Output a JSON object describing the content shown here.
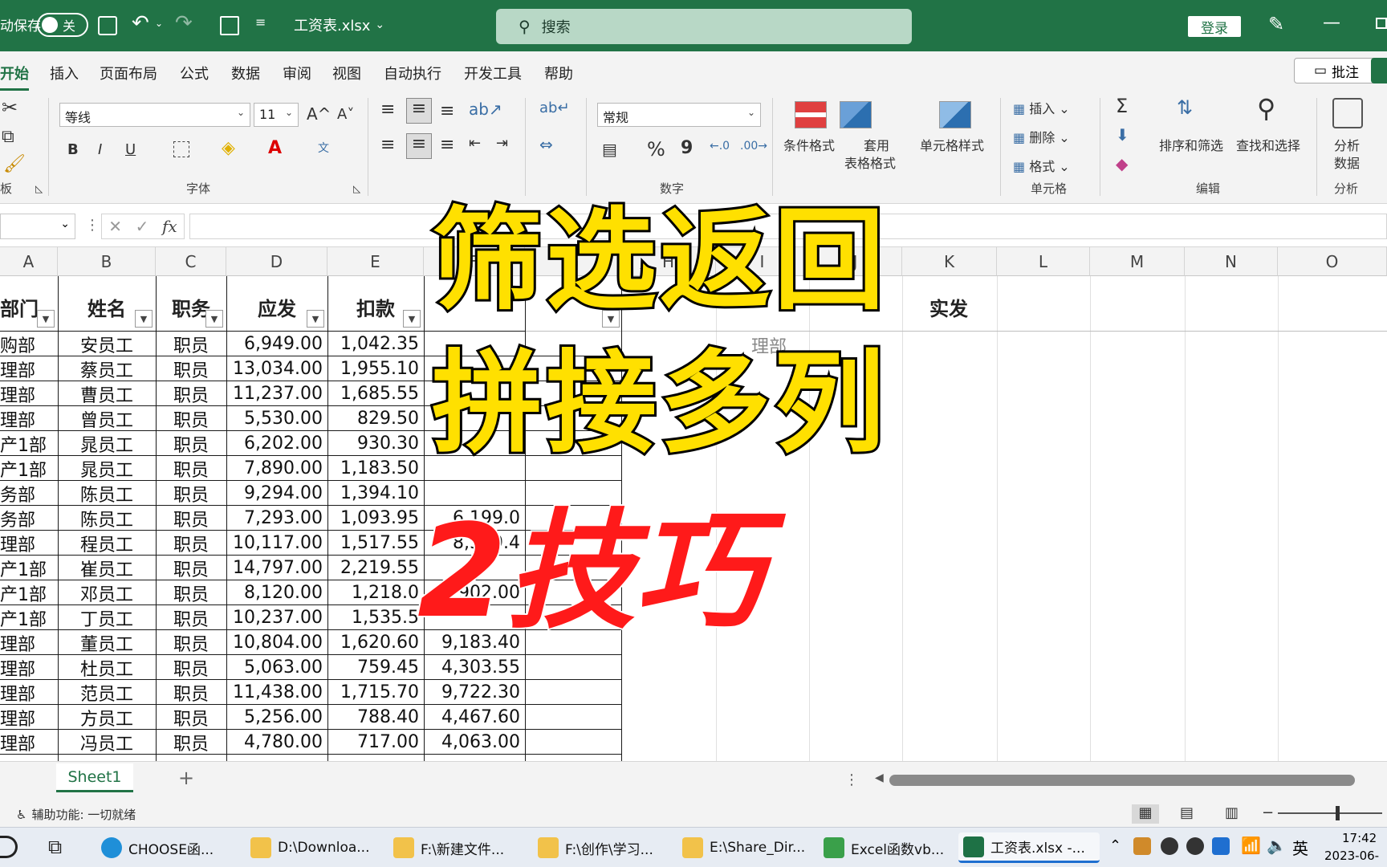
{
  "titlebar": {
    "autosave_label": "动保存",
    "autosave_state": "关",
    "filename": "工资表.xlsx",
    "search_placeholder": "搜索",
    "login": "登录"
  },
  "menu": {
    "tabs": [
      "开始",
      "插入",
      "页面布局",
      "公式",
      "数据",
      "审阅",
      "视图",
      "自动执行",
      "开发工具",
      "帮助"
    ],
    "comment_button": "批注"
  },
  "ribbon": {
    "font_name": "等线",
    "font_size": "11",
    "number_format": "常规",
    "bold": "B",
    "italic": "I",
    "underline": "U",
    "grow_font": "A^",
    "shrink_font": "A˅",
    "font_group": "字体",
    "number_group": "数字",
    "percent": "%",
    "comma": "9",
    "conditional_format": "条件格式",
    "table_format_1": "套用",
    "table_format_2": "表格格式",
    "cell_style": "单元格样式",
    "insert": "插入",
    "delete": "删除",
    "format": "格式",
    "cells_group": "单元格",
    "sort_filter": "排序和筛选",
    "find_select": "查找和选择",
    "edit_group": "编辑",
    "analyze_1": "分析",
    "analyze_2": "数据",
    "analyze_group": "分析",
    "clipboard_group": "板"
  },
  "formula_bar": {
    "fx": "fx",
    "cancel": "✕",
    "confirm": "✓"
  },
  "sheet": {
    "columns": [
      "A",
      "B",
      "C",
      "D",
      "E",
      "F",
      "G",
      "H",
      "I",
      "J",
      "K",
      "L",
      "M",
      "N",
      "O"
    ],
    "headers": [
      "部门",
      "姓名",
      "职务",
      "应发",
      "扣款"
    ],
    "extra_header": "实发",
    "ghost_text": "理部",
    "rows": [
      [
        "购部",
        "安员工",
        "职员",
        "6,949.00",
        "1,042.35",
        ""
      ],
      [
        "理部",
        "蔡员工",
        "职员",
        "13,034.00",
        "1,955.10",
        ""
      ],
      [
        "理部",
        "曹员工",
        "职员",
        "11,237.00",
        "1,685.55",
        ""
      ],
      [
        "理部",
        "曾员工",
        "职员",
        "5,530.00",
        "829.50",
        ""
      ],
      [
        "产1部",
        "晁员工",
        "职员",
        "6,202.00",
        "930.30",
        ""
      ],
      [
        "产1部",
        "晁员工",
        "职员",
        "7,890.00",
        "1,183.50",
        ""
      ],
      [
        "务部",
        "陈员工",
        "职员",
        "9,294.00",
        "1,394.10",
        ""
      ],
      [
        "务部",
        "陈员工",
        "职员",
        "7,293.00",
        "1,093.95",
        "6,199.0"
      ],
      [
        "理部",
        "程员工",
        "职员",
        "10,117.00",
        "1,517.55",
        "8,599.4"
      ],
      [
        "产1部",
        "崔员工",
        "职员",
        "14,797.00",
        "2,219.55",
        ""
      ],
      [
        "产1部",
        "邓员工",
        "职员",
        "8,120.00",
        "1,218.0",
        "902.00"
      ],
      [
        "产1部",
        "丁员工",
        "职员",
        "10,237.00",
        "1,535.5",
        ""
      ],
      [
        "理部",
        "董员工",
        "职员",
        "10,804.00",
        "1,620.60",
        "9,183.40"
      ],
      [
        "理部",
        "杜员工",
        "职员",
        "5,063.00",
        "759.45",
        "4,303.55"
      ],
      [
        "理部",
        "范员工",
        "职员",
        "11,438.00",
        "1,715.70",
        "9,722.30"
      ],
      [
        "理部",
        "方员工",
        "职员",
        "5,256.00",
        "788.40",
        "4,467.60"
      ],
      [
        "理部",
        "冯员工",
        "职员",
        "4,780.00",
        "717.00",
        "4,063.00"
      ]
    ],
    "tab_name": "Sheet1",
    "add_sheet": "+"
  },
  "overlay": {
    "line1": "筛选返回",
    "line2": "拼接多列",
    "line3": "2技巧"
  },
  "statusbar": {
    "accessibility": "辅助功能: 一切就绪"
  },
  "taskbar": {
    "items": [
      "CHOOSE函...",
      "D:\\Downloa...",
      "F:\\新建文件...",
      "F:\\创作\\学习...",
      "E:\\Share_Dir...",
      "Excel函数vb...",
      "工资表.xlsx -..."
    ],
    "ime": "英",
    "time": "17:42",
    "date": "2023-06-"
  },
  "colors": {
    "excel_green": "#217346",
    "overlay_yellow": "#ffe000",
    "overlay_red": "#ff1a1a"
  }
}
